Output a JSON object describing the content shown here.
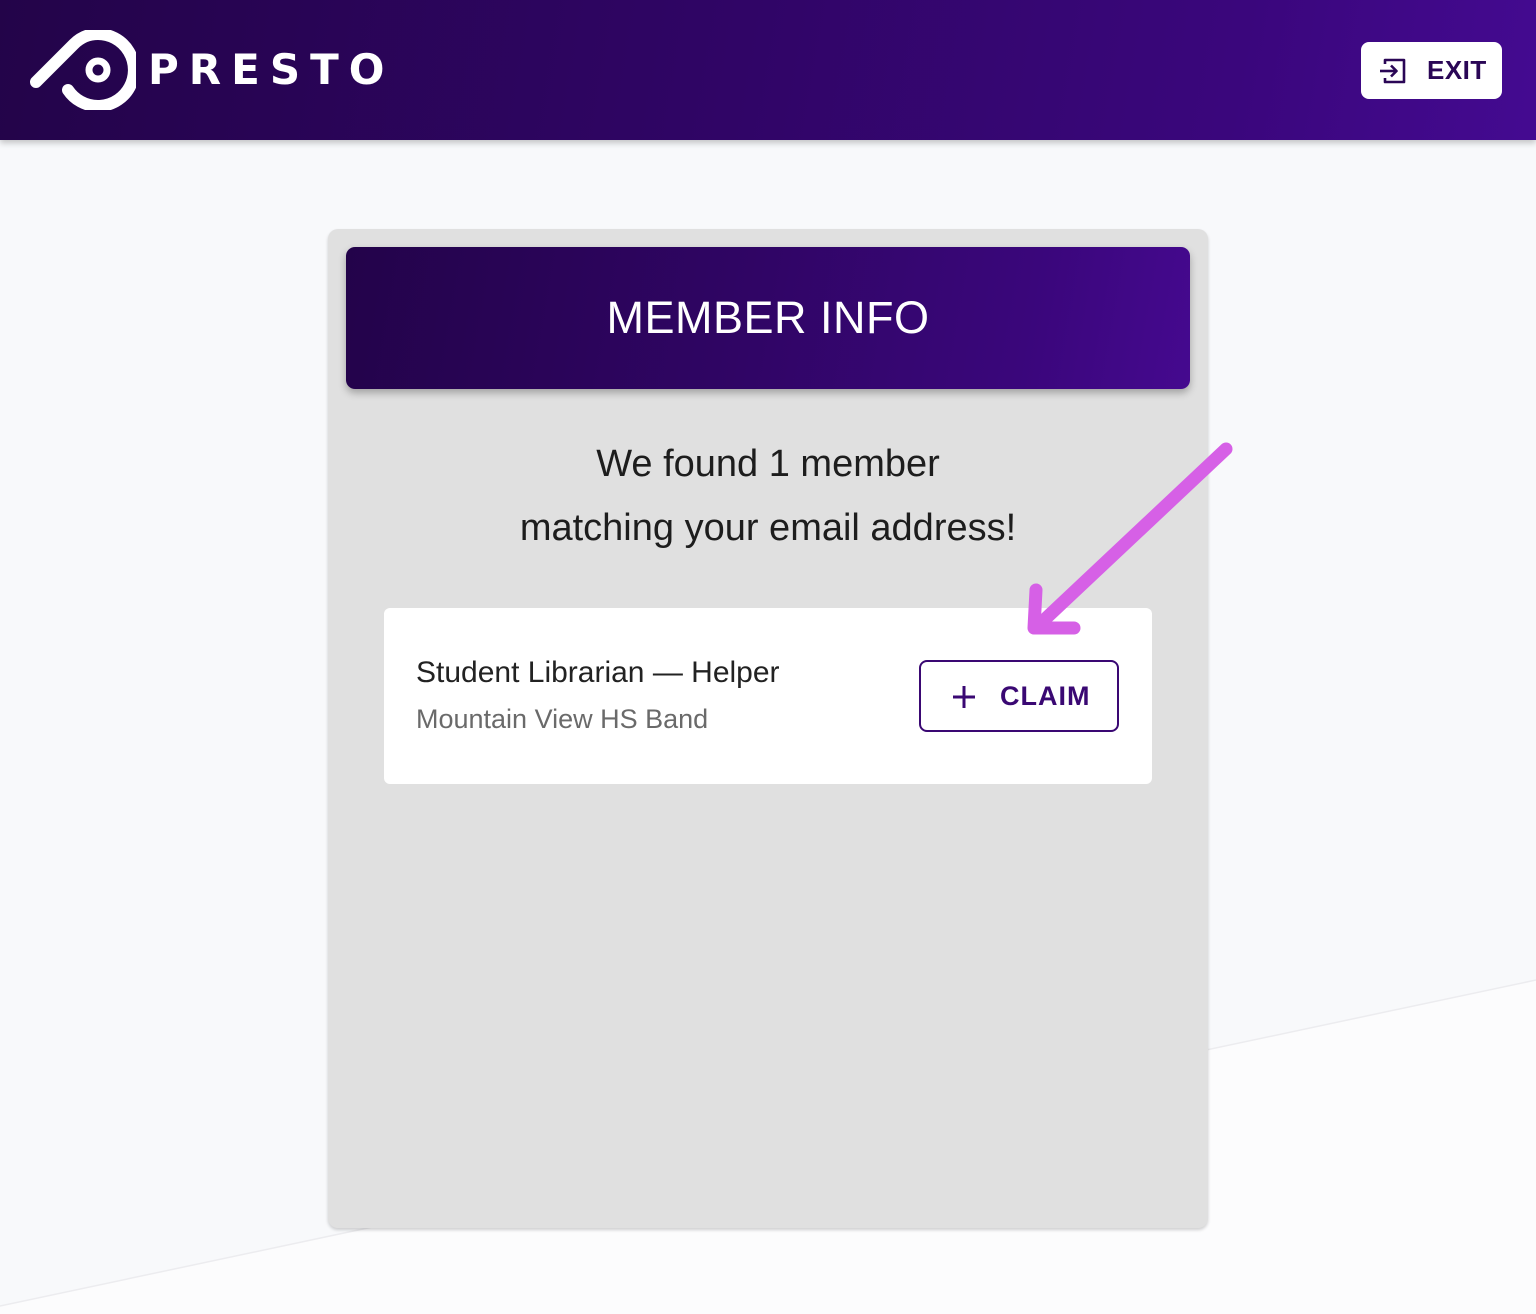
{
  "header": {
    "brand_name": "PRESTO",
    "logo_icon": "presto-logo-icon",
    "exit_icon": "exit-icon",
    "exit_label": "EXIT"
  },
  "card": {
    "title": "MEMBER INFO",
    "message_line1": "We found 1 member",
    "message_line2": "matching your email address!",
    "members": [
      {
        "role": "Student Librarian — Helper",
        "organization": "Mountain View HS Band",
        "action_label": "CLAIM",
        "action_icon": "plus-icon"
      }
    ]
  },
  "annotation": {
    "icon": "arrow-pointer-icon",
    "color": "#d660e6"
  },
  "colors": {
    "brand_dark": "#23034a",
    "brand_light": "#45098f",
    "card_bg": "#e0e0e0",
    "button_text": "#3a0873"
  }
}
